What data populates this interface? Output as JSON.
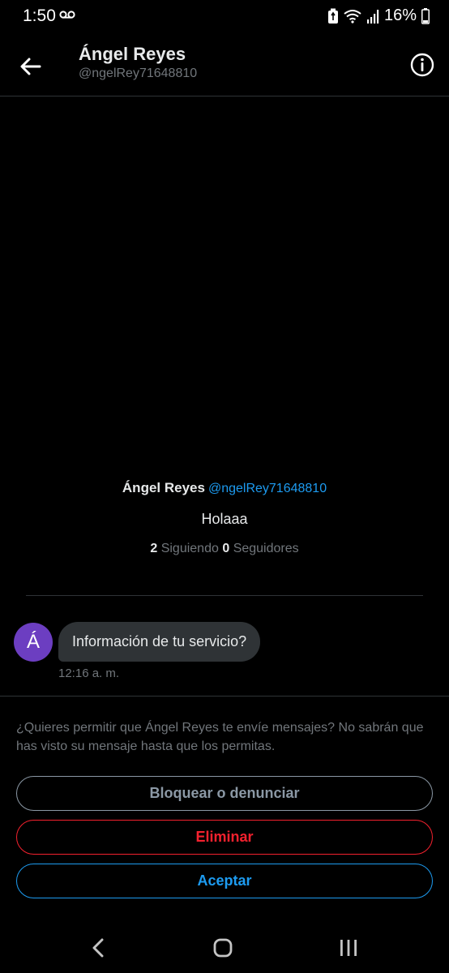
{
  "status_bar": {
    "time": "1:50",
    "battery": "16%",
    "icons": [
      "voicemail-icon",
      "battery-saver-icon",
      "wifi-icon",
      "signal-icon",
      "battery-icon"
    ]
  },
  "header": {
    "name": "Ángel Reyes",
    "handle": "@ngelRey71648810",
    "icons": [
      "back-arrow-icon",
      "info-icon"
    ]
  },
  "profile": {
    "name": "Ángel Reyes",
    "handle": "@ngelRey71648810",
    "bio": "Holaaa",
    "following_count": "2",
    "following_label": "Siguiendo",
    "followers_count": "0",
    "followers_label": "Seguidores"
  },
  "message": {
    "avatar_initial": "Á",
    "text": "Información de tu servicio?",
    "time": "12:16 a. m."
  },
  "request": {
    "prompt": "¿Quieres permitir que Ángel Reyes te envíe mensajes? No sabrán que has visto su mensaje hasta que los permitas.",
    "block_label": "Bloquear o denunciar",
    "delete_label": "Eliminar",
    "accept_label": "Aceptar"
  },
  "colors": {
    "background": "#000000",
    "accent": "#1d9bf0",
    "danger": "#f4212e",
    "avatar": "#6c3ec1",
    "bubble": "#2f3336"
  },
  "nav_bar": {
    "icons": [
      "nav-back-icon",
      "nav-home-icon",
      "nav-recents-icon"
    ]
  }
}
